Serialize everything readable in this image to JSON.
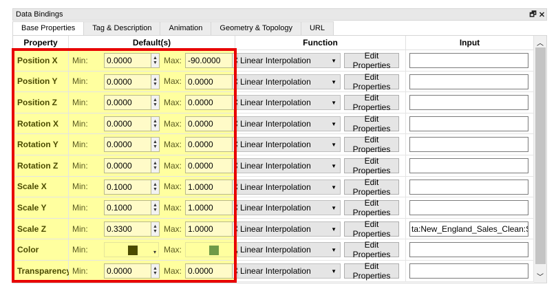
{
  "window": {
    "title": "Data Bindings",
    "float_glyph": "🗗",
    "close_glyph": "✕"
  },
  "tabs": [
    {
      "label": "Base Properties",
      "active": true
    },
    {
      "label": "Tag & Description",
      "active": false
    },
    {
      "label": "Animation",
      "active": false
    },
    {
      "label": "Geometry & Topology",
      "active": false
    },
    {
      "label": "URL",
      "active": false
    }
  ],
  "columns": {
    "property": "Property",
    "defaults": "Default(s)",
    "function": "Function",
    "input": "Input"
  },
  "labels": {
    "min": "Min:",
    "max": "Max:"
  },
  "rows": [
    {
      "property": "Position X",
      "min": "0.0000",
      "max": "-90.0000",
      "function": "Linear Interpolation",
      "edit": "Edit Properties",
      "input": ""
    },
    {
      "property": "Position Y",
      "min": "0.0000",
      "max": "0.0000",
      "function": "Linear Interpolation",
      "edit": "Edit Properties",
      "input": ""
    },
    {
      "property": "Position Z",
      "min": "0.0000",
      "max": "0.0000",
      "function": "Linear Interpolation",
      "edit": "Edit Properties",
      "input": ""
    },
    {
      "property": "Rotation X",
      "min": "0.0000",
      "max": "0.0000",
      "function": "Linear Interpolation",
      "edit": "Edit Properties",
      "input": ""
    },
    {
      "property": "Rotation Y",
      "min": "0.0000",
      "max": "0.0000",
      "function": "Linear Interpolation",
      "edit": "Edit Properties",
      "input": ""
    },
    {
      "property": "Rotation Z",
      "min": "0.0000",
      "max": "0.0000",
      "function": "Linear Interpolation",
      "edit": "Edit Properties",
      "input": ""
    },
    {
      "property": "Scale X",
      "min": "0.1000",
      "max": "1.0000",
      "function": "Linear Interpolation",
      "edit": "Edit Properties",
      "input": ""
    },
    {
      "property": "Scale Y",
      "min": "0.1000",
      "max": "1.0000",
      "function": "Linear Interpolation",
      "edit": "Edit Properties",
      "input": ""
    },
    {
      "property": "Scale Z",
      "min": "0.3300",
      "max": "1.0000",
      "function": "Linear Interpolation",
      "edit": "Edit Properties",
      "input": "ta:New_England_Sales_Clean:Size"
    },
    {
      "property": "Color",
      "min_color": "#4b4b00",
      "max_color": "#6f9a48",
      "function": "Linear Interpolation",
      "edit": "Edit Properties",
      "input": ""
    },
    {
      "property": "Transparency",
      "min": "0.0000",
      "max": "0.0000",
      "function": "Linear Interpolation",
      "edit": "Edit Properties",
      "input": ""
    }
  ],
  "colors": {
    "highlight_border": "#e80000",
    "row_fill": "#ffff9f",
    "property_text": "#4b4b00"
  }
}
